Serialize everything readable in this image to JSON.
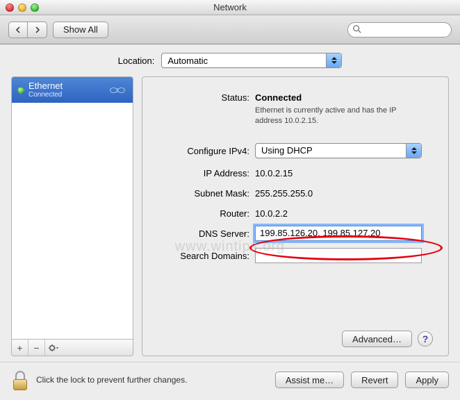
{
  "window": {
    "title": "Network"
  },
  "toolbar": {
    "show_all": "Show All",
    "search_placeholder": ""
  },
  "location": {
    "label": "Location:",
    "value": "Automatic"
  },
  "sidebar": {
    "interfaces": [
      {
        "name": "Ethernet",
        "status": "Connected"
      }
    ],
    "buttons": {
      "add": "+",
      "remove": "−",
      "action": "✻▾"
    }
  },
  "details": {
    "labels": {
      "status": "Status:",
      "configure": "Configure IPv4:",
      "ip": "IP Address:",
      "subnet": "Subnet Mask:",
      "router": "Router:",
      "dns": "DNS Server:",
      "search": "Search Domains:"
    },
    "status_value": "Connected",
    "status_sub": "Ethernet is currently active and has the IP address 10.0.2.15.",
    "configure_value": "Using DHCP",
    "ip_value": "10.0.2.15",
    "subnet_value": "255.255.255.0",
    "router_value": "10.0.2.2",
    "dns_value": "199.85.126.20, 199.85.127.20",
    "search_value": "",
    "advanced": "Advanced…",
    "help": "?"
  },
  "bottom": {
    "lock_text": "Click the lock to prevent further changes.",
    "assist": "Assist me…",
    "revert": "Revert",
    "apply": "Apply"
  },
  "watermark": "www.wintips.org"
}
